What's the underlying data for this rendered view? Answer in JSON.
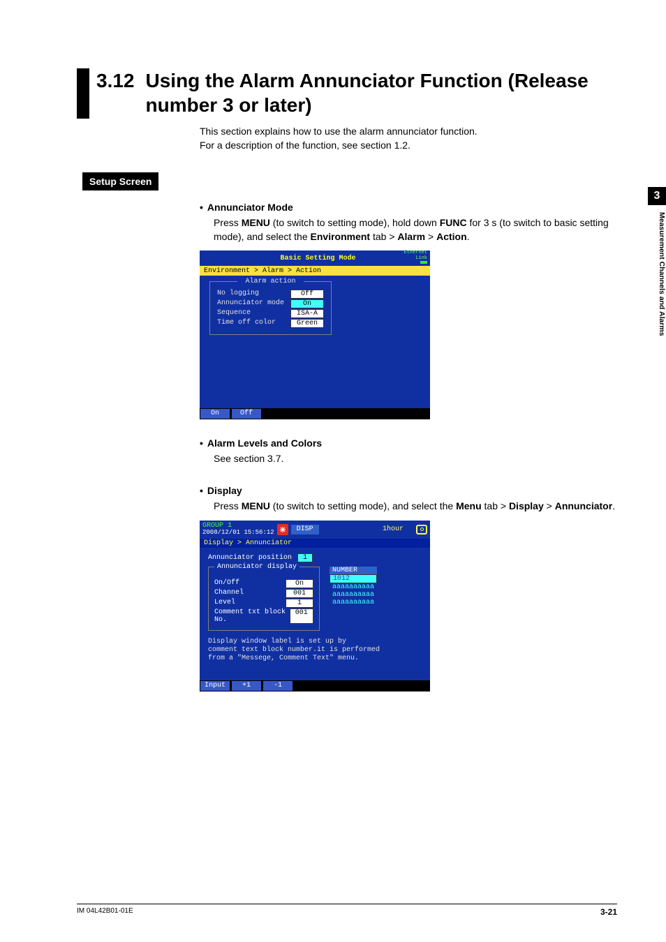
{
  "section_number": "3.12",
  "section_title": "Using the Alarm Annunciator Function (Release number 3 or later)",
  "intro_line1": "This section explains how to use the alarm annunciator function.",
  "intro_line2": "For a description of the function, see section 1.2.",
  "setup_screen_label": "Setup Screen",
  "annunciator_mode": {
    "heading": "Annunciator Mode",
    "press": "Press ",
    "menu": "MENU",
    "text1": " (to switch to setting mode), hold down ",
    "func": "FUNC",
    "text2": " for 3 s (to switch to basic setting mode), and select the ",
    "env": "Environment",
    "gt1": " tab > ",
    "alarm": "Alarm",
    "gt2": " > ",
    "action": "Action",
    "period": "."
  },
  "ss1": {
    "title": "Basic Setting Mode",
    "eth1": "Ethernet",
    "eth2": "Link",
    "crumb": "Environment > Alarm > Action",
    "legend": "Alarm action",
    "rows": [
      {
        "label": "No logging",
        "value": "Off",
        "selected": false
      },
      {
        "label": "Annunciator mode",
        "value": "On",
        "selected": true
      },
      {
        "label": "Sequence",
        "value": "ISA-A",
        "selected": false
      },
      {
        "label": "Time off color",
        "value": "Green",
        "selected": false
      }
    ],
    "sk1": "On",
    "sk2": "Off"
  },
  "alarm_levels": {
    "heading": "Alarm Levels and Colors",
    "text": "See section 3.7."
  },
  "display": {
    "heading": "Display",
    "press": "Press ",
    "menu": "MENU",
    "text1": " (to switch to setting mode), and select the ",
    "menutab": "Menu",
    "gt1": " tab > ",
    "disp": "Display",
    "gt2": " > ",
    "ann": "Annunciator",
    "period": "."
  },
  "ss2": {
    "group": "GROUP 1",
    "timestamp": "2008/12/01 15:56:12",
    "disp_label": "DISP",
    "hour": "1hour",
    "crumb": "Display > Annunciator",
    "pos_label": "Annunciator position",
    "pos_value": "1",
    "legend": "Annunciator display",
    "rows": [
      {
        "label": "On/Off",
        "value": "On"
      },
      {
        "label": "Channel",
        "value": "001"
      },
      {
        "label": "Level",
        "value": "1"
      },
      {
        "label": "Comment txt block No.",
        "value": "001"
      }
    ],
    "numhead": "NUMBER",
    "numsel": "1012",
    "numa": "aaaaaaaaaa",
    "hint1": "Display window label is set up by",
    "hint2": "comment text block number.it is performed",
    "hint3": "from a \"Messege, Comment Text\" menu.",
    "sk1": "Input",
    "sk2": "+1",
    "sk3": "-1"
  },
  "side": {
    "chapter": "3",
    "label": "Measurement Channels and Alarms"
  },
  "footer": {
    "manual": "IM 04L42B01-01E",
    "page": "3-21"
  }
}
